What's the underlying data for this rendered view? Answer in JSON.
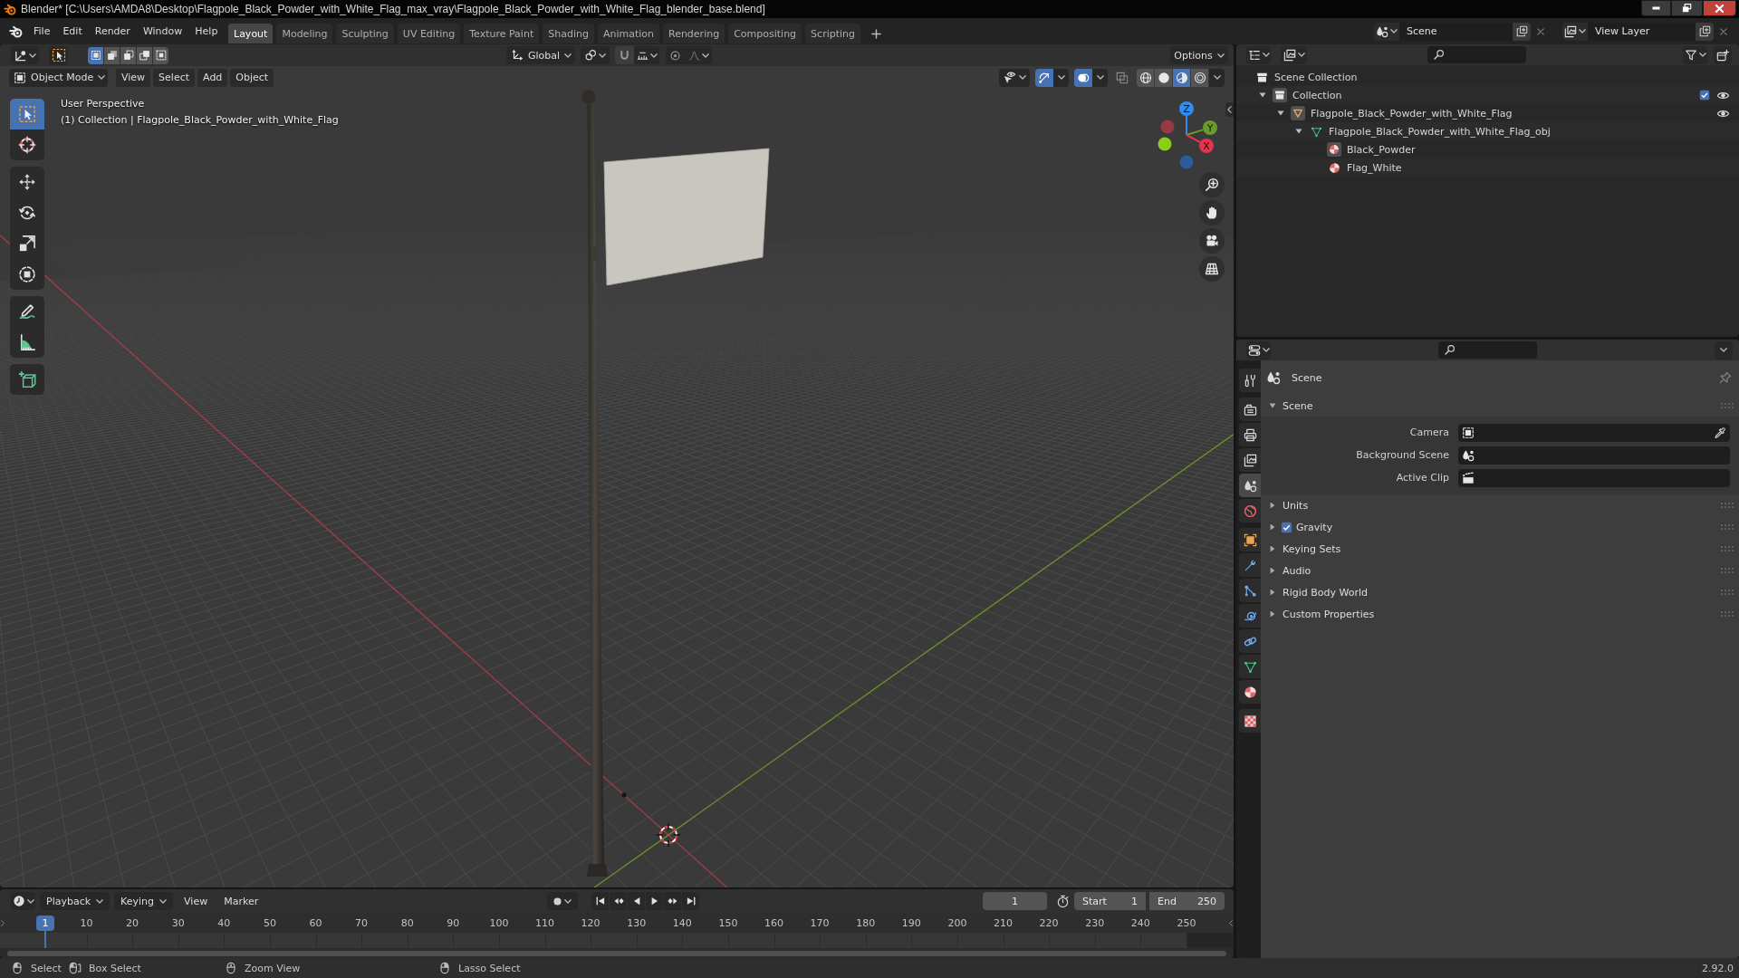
{
  "window": {
    "title": "Blender* [C:\\Users\\AMDA8\\Desktop\\Flagpole_Black_Powder_with_White_Flag_max_vray\\Flagpole_Black_Powder_with_White_Flag_blender_base.blend]"
  },
  "menu": [
    "File",
    "Edit",
    "Render",
    "Window",
    "Help"
  ],
  "workspace_tabs": [
    {
      "label": "Layout",
      "selected": true
    },
    {
      "label": "Modeling",
      "selected": false
    },
    {
      "label": "Sculpting",
      "selected": false
    },
    {
      "label": "UV Editing",
      "selected": false
    },
    {
      "label": "Texture Paint",
      "selected": false
    },
    {
      "label": "Shading",
      "selected": false
    },
    {
      "label": "Animation",
      "selected": false
    },
    {
      "label": "Rendering",
      "selected": false
    },
    {
      "label": "Compositing",
      "selected": false
    },
    {
      "label": "Scripting",
      "selected": false
    }
  ],
  "scene_selector": {
    "value": "Scene"
  },
  "view_layer_selector": {
    "value": "View Layer"
  },
  "viewport": {
    "select_modes": [
      {
        "kind": "set",
        "selected": true
      },
      {
        "kind": "extend",
        "selected": false
      },
      {
        "kind": "subtract",
        "selected": false
      },
      {
        "kind": "difference",
        "selected": false
      },
      {
        "kind": "intersect",
        "selected": false
      }
    ],
    "orientation": "Global",
    "options": "Options",
    "mode": "Object Mode",
    "menu": [
      "View",
      "Select",
      "Add",
      "Object"
    ],
    "toggles": [
      {
        "kind": "gizmos",
        "on": true
      },
      {
        "kind": "overlays",
        "on": true
      },
      {
        "kind": "xray",
        "on": false
      }
    ],
    "shading": [
      {
        "kind": "wireframe",
        "selected": false
      },
      {
        "kind": "solid",
        "selected": false
      },
      {
        "kind": "material",
        "selected": true
      },
      {
        "kind": "rendered",
        "selected": false
      }
    ],
    "info": [
      "User Perspective",
      "(1) Collection | Flagpole_Black_Powder_with_White_Flag"
    ],
    "tools": [
      [
        {
          "kind": "select",
          "selected": true
        },
        {
          "kind": "cursor",
          "selected": false
        }
      ],
      [
        {
          "kind": "move",
          "selected": false
        },
        {
          "kind": "rotate",
          "selected": false
        },
        {
          "kind": "scale",
          "selected": false
        },
        {
          "kind": "transform",
          "selected": false
        }
      ],
      [
        {
          "kind": "annotate",
          "selected": false
        },
        {
          "kind": "measure",
          "selected": false
        }
      ],
      [
        {
          "kind": "add_cube",
          "selected": false
        }
      ]
    ],
    "axes": [
      {
        "kind": "z",
        "label": "Z"
      },
      {
        "kind": "y",
        "label": "Y"
      },
      {
        "kind": "x",
        "label": "X"
      }
    ]
  },
  "outliner": {
    "items": [
      {
        "label": "Scene Collection",
        "kind": "scene_collection",
        "active": false,
        "children": [
          {
            "label": "Collection",
            "kind": "collection",
            "active": true,
            "expanded": true,
            "checked": true,
            "visible": true,
            "children": [
              {
                "label": "Flagpole_Black_Powder_with_White_Flag",
                "kind": "object",
                "active": true,
                "expanded": true,
                "visible": true,
                "children": [
                  {
                    "label": "Flagpole_Black_Powder_with_White_Flag_obj",
                    "kind": "mesh",
                    "active": false,
                    "expanded": true,
                    "children": [
                      {
                        "label": "Black_Powder",
                        "kind": "material",
                        "active": true
                      },
                      {
                        "label": "Flag_White",
                        "kind": "material",
                        "active": false
                      }
                    ]
                  }
                ]
              }
            ]
          }
        ]
      }
    ]
  },
  "properties": {
    "tabs": [
      [
        {
          "kind": "tool",
          "selected": false
        }
      ],
      [
        {
          "kind": "render",
          "selected": false
        },
        {
          "kind": "output",
          "selected": false
        },
        {
          "kind": "view_layer",
          "selected": false
        },
        {
          "kind": "scene",
          "selected": true
        },
        {
          "kind": "world",
          "selected": false
        }
      ],
      [
        {
          "kind": "object",
          "selected": false
        },
        {
          "kind": "modifiers",
          "selected": false
        },
        {
          "kind": "particles",
          "selected": false
        },
        {
          "kind": "physics",
          "selected": false
        },
        {
          "kind": "constraints",
          "selected": false
        },
        {
          "kind": "data",
          "selected": false
        },
        {
          "kind": "material",
          "selected": false
        }
      ],
      [
        {
          "kind": "texture",
          "selected": false
        }
      ]
    ],
    "context": "Scene",
    "panels": [
      {
        "label": "Scene",
        "expanded": true,
        "fields": [
          {
            "label": "Camera",
            "kind": "camera"
          },
          {
            "label": "Background Scene",
            "kind": "scene"
          },
          {
            "label": "Active Clip",
            "kind": "clip"
          }
        ]
      },
      {
        "label": "Units",
        "expanded": false
      },
      {
        "label": "Gravity",
        "expanded": false,
        "checked": true
      },
      {
        "label": "Keying Sets",
        "expanded": false
      },
      {
        "label": "Audio",
        "expanded": false
      },
      {
        "label": "Rigid Body World",
        "expanded": false
      },
      {
        "label": "Custom Properties",
        "expanded": false
      }
    ]
  },
  "timeline": {
    "menu": [
      {
        "label": "Playback",
        "kind": "dropdown"
      },
      {
        "label": "Keying",
        "kind": "dropdown"
      },
      {
        "label": "View",
        "kind": "menu"
      },
      {
        "label": "Marker",
        "kind": "menu"
      }
    ],
    "current_frame": "1",
    "start": {
      "label": "Start",
      "value": "1"
    },
    "end": {
      "label": "End",
      "value": "250"
    },
    "playhead": "1",
    "ticks": [
      "10",
      "20",
      "30",
      "40",
      "50",
      "60",
      "70",
      "80",
      "90",
      "100",
      "110",
      "120",
      "130",
      "140",
      "150",
      "160",
      "170",
      "180",
      "190",
      "200",
      "210",
      "220",
      "230",
      "240",
      "250"
    ]
  },
  "status_bar": {
    "hints": [
      {
        "kind": "left",
        "label": "Select"
      },
      {
        "kind": "drag",
        "label": "Box Select"
      },
      {
        "kind": "middle",
        "label": "Zoom View"
      },
      {
        "kind": "right",
        "label": "Lasso Select"
      }
    ],
    "version": "2.92.0"
  }
}
